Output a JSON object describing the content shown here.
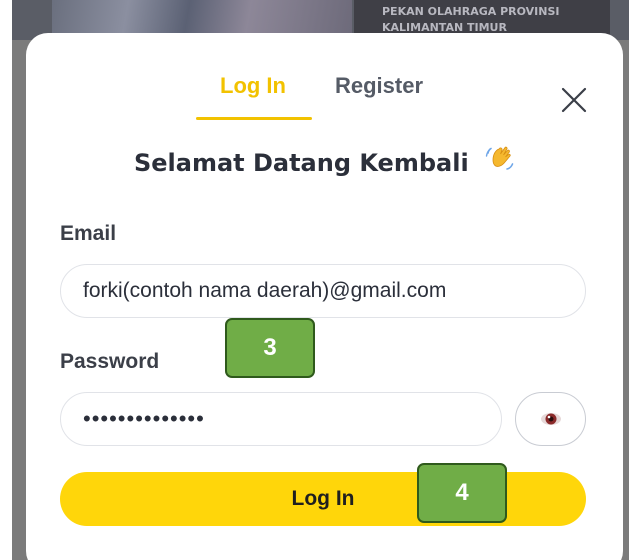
{
  "background": {
    "banner_lines": [
      "PEKAN OLAHRAGA PROVINSI",
      "KALIMANTAN TIMUR"
    ]
  },
  "modal": {
    "tabs": [
      {
        "label": "Log In",
        "active": true
      },
      {
        "label": "Register",
        "active": false
      }
    ],
    "close_icon": "close-icon",
    "welcome_text": "Selamat Datang Kembali",
    "welcome_icon": "waving-hand-icon",
    "email": {
      "label": "Email",
      "value": "forki(contoh nama daerah)@gmail.com"
    },
    "password": {
      "label": "Password",
      "value": "••••••••••••••",
      "toggle_icon": "eye-icon"
    },
    "submit_label": "Log In"
  },
  "annotations": [
    {
      "label": "3"
    },
    {
      "label": "4"
    }
  ],
  "colors": {
    "accent": "#f2c200",
    "button": "#ffd60a",
    "marker": "#70ad47",
    "marker_border": "#2f5a1c"
  }
}
